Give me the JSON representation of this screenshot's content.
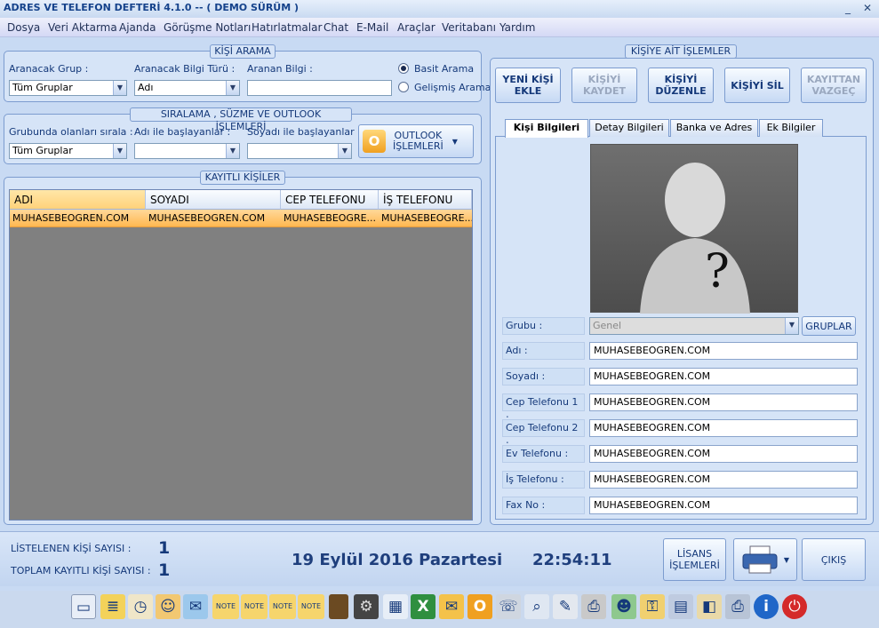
{
  "window": {
    "title": "ADRES VE TELEFON DEFTERİ  4.1.0 -- ( DEMO SÜRÜM )",
    "minimize": "_",
    "close": "✕"
  },
  "menu": [
    "Dosya",
    "Veri Aktarma",
    "Ajanda",
    "Görüşme Notları",
    "Hatırlatmalar",
    "Chat",
    "E-Mail",
    "Araçlar",
    "Veritabanı",
    "Yardım"
  ],
  "search": {
    "title": "KİŞİ ARAMA",
    "group_label": "Aranacak Grup :",
    "group_value": "Tüm Gruplar",
    "type_label": "Aranacak Bilgi Türü :",
    "type_value": "Adı",
    "query_label": "Aranan Bilgi :",
    "query_value": "",
    "basic": "Basit Arama",
    "advanced": "Gelişmiş Arama"
  },
  "sort": {
    "title": "SIRALAMA , SÜZME VE OUTLOOK İŞLEMLERİ",
    "group_label": "Grubunda olanları sırala :",
    "group_value": "Tüm Gruplar",
    "first_label": "Adı ile başlayanlar :",
    "first_value": "",
    "last_label": "Soyadı ile başlayanlar :",
    "last_value": "",
    "outlook_line1": "OUTLOOK",
    "outlook_line2": "İŞLEMLERİ"
  },
  "list": {
    "title": "KAYITLI KİŞİLER",
    "columns": [
      "ADI",
      "SOYADI",
      "CEP TELEFONU",
      "İŞ TELEFONU"
    ],
    "rows": [
      [
        "MUHASEBEOGREN.COM",
        "MUHASEBEOGREN.COM",
        "MUHASEBEOGRE...",
        "MUHASEBEOGRE..."
      ]
    ]
  },
  "ops": {
    "title": "KİŞİYE AİT İŞLEMLER",
    "new_l1": "YENİ KİŞİ",
    "new_l2": "EKLE",
    "save_l1": "KİŞİYİ",
    "save_l2": "KAYDET",
    "edit_l1": "KİŞİYİ",
    "edit_l2": "DÜZENLE",
    "delete": "KİŞİYİ SİL",
    "cancel_l1": "KAYITTAN",
    "cancel_l2": "VAZGEÇ"
  },
  "tabs": [
    "Kişi Bilgileri",
    "Detay Bilgileri",
    "Banka ve Adres",
    "Ek Bilgiler"
  ],
  "form": {
    "group_label": "Grubu :",
    "group_value": "Genel",
    "groups_button": "GRUPLAR",
    "fields": [
      {
        "label": "Adı :",
        "value": "MUHASEBEOGREN.COM"
      },
      {
        "label": "Soyadı :",
        "value": "MUHASEBEOGREN.COM"
      },
      {
        "label": "Cep Telefonu 1 :",
        "value": "MUHASEBEOGREN.COM"
      },
      {
        "label": "Cep Telefonu 2 :",
        "value": "MUHASEBEOGREN.COM"
      },
      {
        "label": "Ev Telefonu :",
        "value": "MUHASEBEOGREN.COM"
      },
      {
        "label": "İş Telefonu :",
        "value": "MUHASEBEOGREN.COM"
      },
      {
        "label": "Fax No :",
        "value": "MUHASEBEOGREN.COM"
      }
    ]
  },
  "status": {
    "listed_label": "LİSTELENEN KİŞİ SAYISI :",
    "listed_value": "1",
    "total_label": "TOPLAM KAYITLI KİŞİ SAYISI :",
    "total_value": "1",
    "date": "19 Eylül 2016 Pazartesi",
    "time": "22:54:11",
    "license_l1": "LİSANS",
    "license_l2": "İŞLEMLERİ",
    "exit": "ÇIKIŞ"
  },
  "taskbar_icons": [
    "notebook-icon",
    "notepad-icon",
    "clock-icon",
    "users-icon",
    "mail-icon",
    "note-icon",
    "note-icon",
    "note-icon",
    "note-icon",
    "book-icon",
    "gear-icon",
    "calendar-icon",
    "excel-icon",
    "email-icon",
    "outlook-icon",
    "fax-icon",
    "search-icon",
    "tools-icon",
    "printer-icon",
    "person-icon",
    "keys-icon",
    "scanner-icon",
    "box-icon",
    "print-icon",
    "info-icon",
    "power-icon"
  ]
}
